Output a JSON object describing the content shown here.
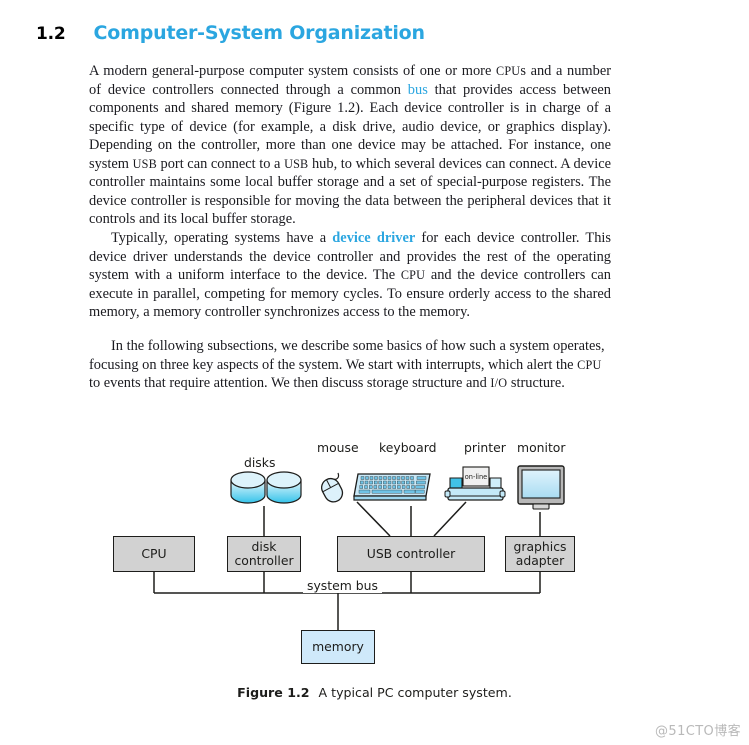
{
  "heading": {
    "number": "1.2",
    "title": "Computer-System Organization"
  },
  "paragraphs": {
    "p1_a": "A modern general-purpose computer system consists of one or more ",
    "p1_cpus": "CPU",
    "p1_b": "s and a number of device controllers connected through a common ",
    "p1_bus": "bus",
    "p1_c": " that provides access between components and shared memory (Figure 1.2). Each device controller is in charge of a specific type of device (for example, a disk drive, audio device, or graphics display). Depending on the controller, more than one device may be attached. For instance, one system ",
    "p1_usb1": "USB",
    "p1_d": " port can connect to a ",
    "p1_usb2": "USB",
    "p1_e": " hub, to which several devices can connect. A device controller maintains some local buffer storage and a set of special-purpose registers. The device controller is responsible for moving the data between the peripheral devices that it controls and its local buffer storage.",
    "p2_a": "Typically, operating systems have a ",
    "p2_driver": "device driver",
    "p2_b": " for each device controller. This device driver understands the device controller and provides the rest of the operating system with a uniform interface to the device. The ",
    "p2_cpu": "CPU",
    "p2_c": " and the device controllers can execute in parallel, competing for memory cycles. To ensure orderly access to the shared memory, a memory controller synchronizes access to the memory.",
    "p3_a": "In the following subsections, we describe some basics of how such a system operates, focusing on three key aspects of the system. We start with interrupts, which alert the ",
    "p3_cpu": "CPU",
    "p3_b": " to events that require attention. We then discuss storage structure and ",
    "p3_io": "I/O",
    "p3_c": " structure."
  },
  "figure": {
    "device_labels": {
      "disks": "disks",
      "mouse": "mouse",
      "keyboard": "keyboard",
      "printer": "printer",
      "monitor": "monitor"
    },
    "printer_paper_text": "on-line",
    "boxes": {
      "cpu": "CPU",
      "disk_controller": "disk\ncontroller",
      "disk_controller_line1": "disk",
      "disk_controller_line2": "controller",
      "usb_controller": "USB controller",
      "graphics_adapter_line1": "graphics",
      "graphics_adapter_line2": "adapter",
      "memory": "memory"
    },
    "bus_label": "system bus",
    "caption_number": "Figure 1.2",
    "caption_text": "A typical PC computer system."
  },
  "watermark": "@51CTO博客",
  "colors": {
    "accent_blue": "#2ba6e0",
    "box_gray": "#d2d2d2",
    "memory_blue": "#cfe9fa",
    "device_cyan": "#7fd3ef",
    "text": "#1d1d1b",
    "watermark_gray": "#b9b9b9"
  }
}
